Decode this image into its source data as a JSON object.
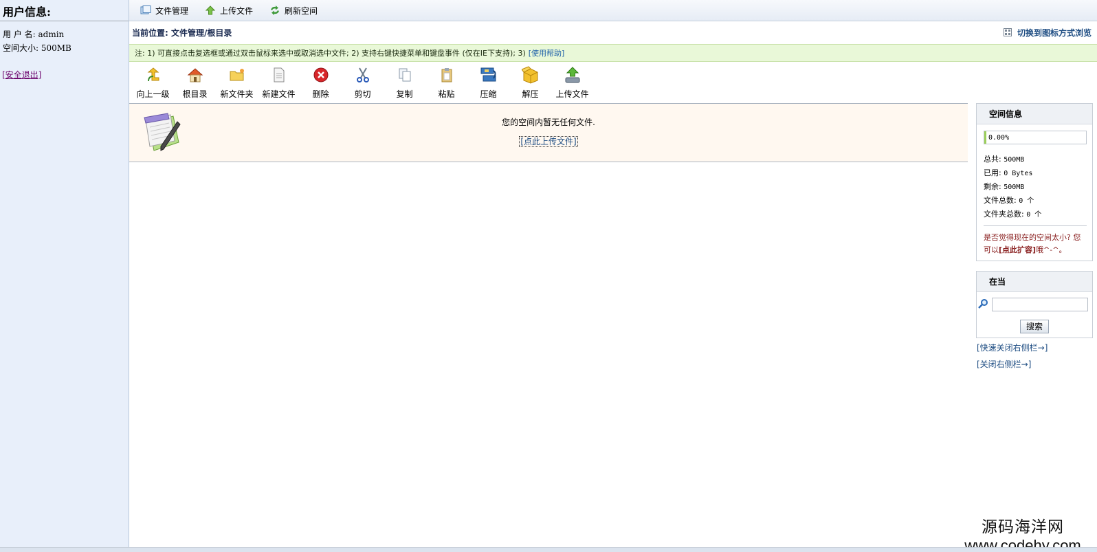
{
  "sidebar": {
    "title": "用户信息:",
    "username_line": "用 户 名: admin",
    "space_line": "空间大小: 500MB",
    "logout": "[安全退出]"
  },
  "topbar": {
    "items": [
      {
        "label": "文件管理",
        "icon": "file-manage-icon"
      },
      {
        "label": "上传文件",
        "icon": "upload-arrow-icon"
      },
      {
        "label": "刷新空间",
        "icon": "refresh-icon"
      }
    ]
  },
  "location": {
    "text": "当前位置: 文件管理/根目录",
    "switch_view": "切换到图标方式浏览"
  },
  "note": {
    "text": "注: 1) 可直接点击复选框或通过双击鼠标来选中或取消选中文件; 2) 支持右键快捷菜单和键盘事件 (仅在IE下支持); 3)",
    "help_link": "[使用帮助]"
  },
  "toolbar": {
    "items": [
      {
        "label": "向上一级",
        "icon": "up-level-icon"
      },
      {
        "label": "根目录",
        "icon": "home-icon"
      },
      {
        "label": "新文件夹",
        "icon": "new-folder-icon"
      },
      {
        "label": "新建文件",
        "icon": "new-file-icon"
      },
      {
        "label": "删除",
        "icon": "delete-icon"
      },
      {
        "label": "剪切",
        "icon": "cut-icon"
      },
      {
        "label": "复制",
        "icon": "copy-icon"
      },
      {
        "label": "粘贴",
        "icon": "paste-icon"
      },
      {
        "label": "压缩",
        "icon": "compress-icon"
      },
      {
        "label": "解压",
        "icon": "extract-icon"
      },
      {
        "label": "上传文件",
        "icon": "upload-icon"
      }
    ]
  },
  "empty": {
    "message": "您的空间内暂无任何文件.",
    "upload_link": "[点此上传文件]"
  },
  "space_info": {
    "title": "空间信息",
    "percent_text": "0.00%",
    "used_fraction": 0.0,
    "total_label": "总共:",
    "total_value": "500MB",
    "used_label": "已用:",
    "used_value": "0 Bytes",
    "remaining_label": "剩余:",
    "remaining_value": "500MB",
    "file_count_label": "文件总数:",
    "file_count_value": "0 个",
    "folder_count_label": "文件夹总数:",
    "folder_count_value": "0 个",
    "tip_before": "是否觉得现在的空间太小? 您可以",
    "tip_link": "[点此扩容]",
    "tip_after": "哦^-^。"
  },
  "search": {
    "title": "在当",
    "placeholder": "",
    "button": "搜索"
  },
  "right_links": {
    "quick_close": "[快速关闭右侧栏→]",
    "close": "[关闭右侧栏→]"
  },
  "watermark": {
    "line1": "源码海洋网",
    "line2": "www.codehy.com"
  },
  "colors": {
    "sidebar_bg": "#e8effa",
    "note_bg": "#e9f8d8",
    "empty_bg": "#fff8f0",
    "link": "#1d4c82",
    "tip": "#8a2020"
  }
}
